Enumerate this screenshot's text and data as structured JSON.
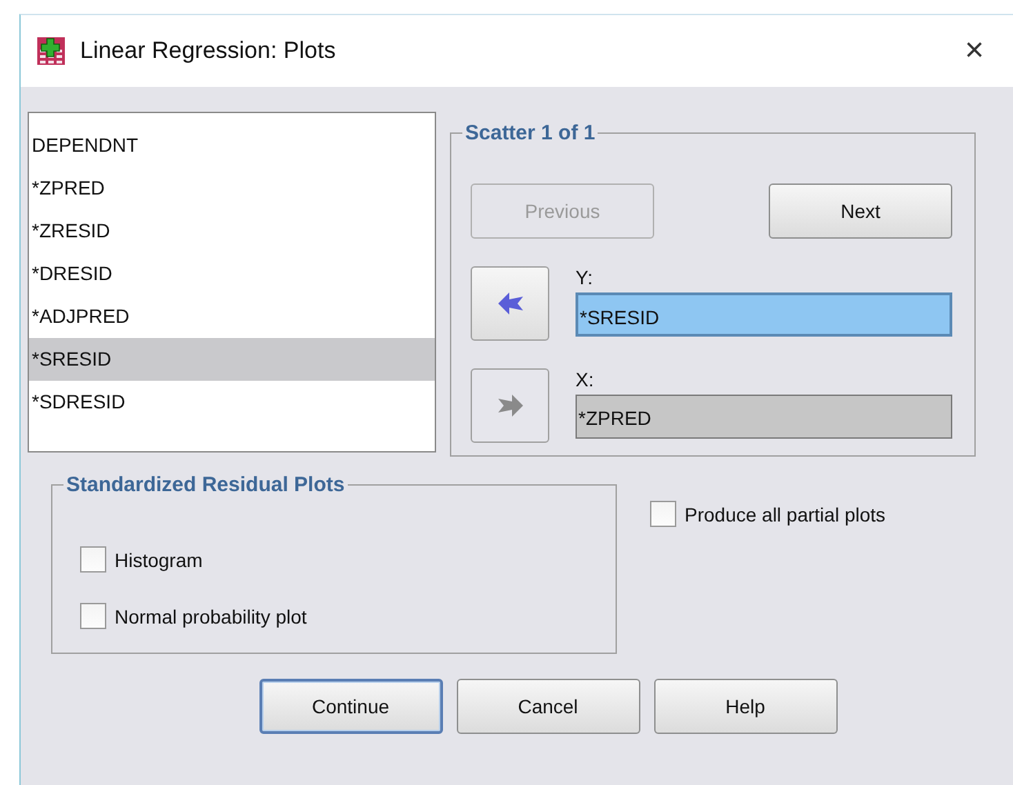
{
  "window": {
    "title": "Linear Regression: Plots",
    "close": "×"
  },
  "variables": [
    {
      "label": "DEPENDNT",
      "selected": false
    },
    {
      "label": "*ZPRED",
      "selected": false
    },
    {
      "label": "*ZRESID",
      "selected": false
    },
    {
      "label": "*DRESID",
      "selected": false
    },
    {
      "label": "*ADJPRED",
      "selected": false
    },
    {
      "label": "*SRESID",
      "selected": true
    },
    {
      "label": "*SDRESID",
      "selected": false
    }
  ],
  "scatter": {
    "title": "Scatter 1 of 1",
    "previous": {
      "label": "Previous",
      "disabled": true
    },
    "next": {
      "label": "Next",
      "disabled": false
    },
    "targets": [
      {
        "label": "Y:",
        "value": "*SRESID",
        "selected": true,
        "arrow": {
          "kind": "left",
          "disabled": false
        }
      },
      {
        "label": "X:",
        "value": "*ZPRED",
        "selected": false,
        "arrow": {
          "kind": "right",
          "disabled": true
        }
      }
    ]
  },
  "residual_plots": {
    "title": "Standardized Residual Plots",
    "options": [
      {
        "label": "Histogram",
        "checked": false
      },
      {
        "label": "Normal probability plot",
        "checked": false
      }
    ]
  },
  "partial_plots": {
    "label": "Produce all partial plots",
    "checked": false
  },
  "buttons": [
    {
      "label": "Continue",
      "default": true
    },
    {
      "label": "Cancel",
      "default": false
    },
    {
      "label": "Help",
      "default": false
    }
  ]
}
